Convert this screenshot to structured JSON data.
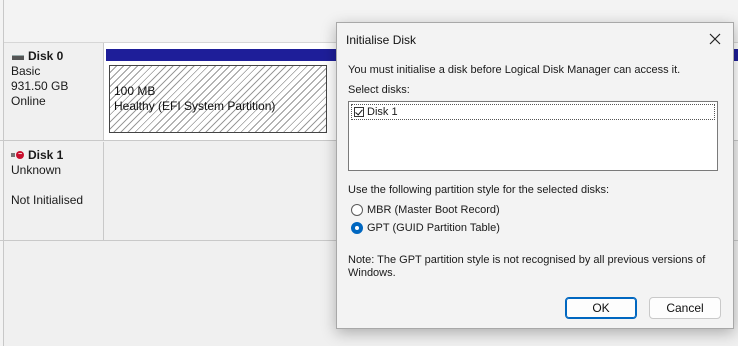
{
  "disks": [
    {
      "name": "Disk 0",
      "type": "Basic",
      "size": "931.50 GB",
      "status": "Online",
      "partition": {
        "size": "100 MB",
        "status": "Healthy (EFI System Partition)"
      }
    },
    {
      "name": "Disk 1",
      "type": "Unknown",
      "status": "Not Initialised"
    }
  ],
  "dialog": {
    "title": "Initialise Disk",
    "intro": "You must initialise a disk before Logical Disk Manager can access it.",
    "select_label": "Select disks:",
    "disk_items": [
      {
        "label": "Disk 1",
        "checked": true
      }
    ],
    "style_label": "Use the following partition style for the selected disks:",
    "options": [
      {
        "label": "MBR (Master Boot Record)",
        "selected": false
      },
      {
        "label": "GPT (GUID Partition Table)",
        "selected": true
      }
    ],
    "note": "Note: The GPT partition style is not recognised by all previous versions of Windows.",
    "ok_label": "OK",
    "cancel_label": "Cancel"
  },
  "colors": {
    "accent": "#0067c0",
    "partition_header": "#1e1e99",
    "error_icon": "#c8102e"
  }
}
